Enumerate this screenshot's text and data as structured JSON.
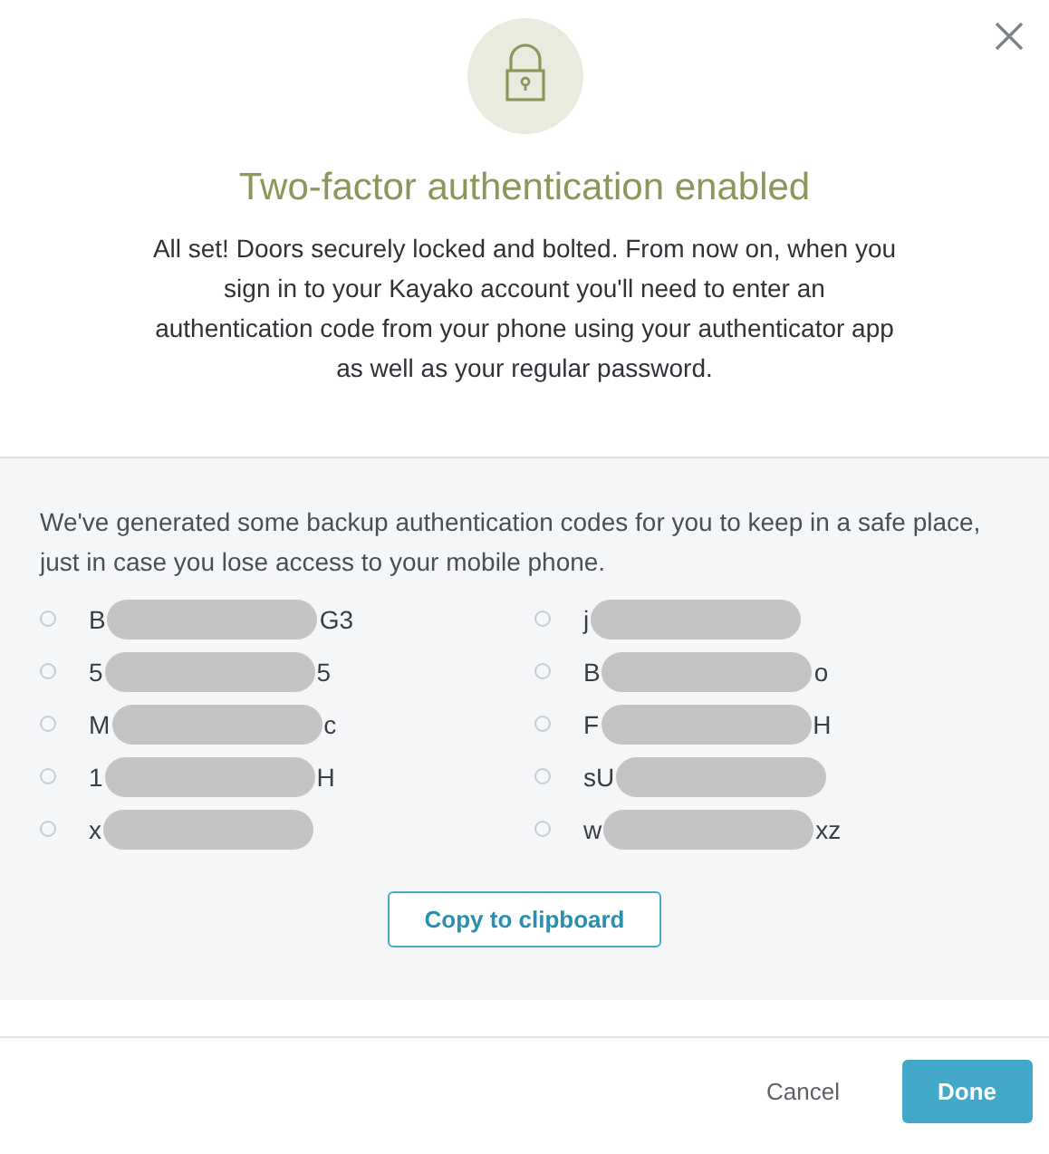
{
  "dialog": {
    "title": "Two-factor authentication enabled",
    "message": "All set! Doors securely locked and bolted. From now on, when you sign in to your Kayako account you'll need to enter an authentication code from your phone using your authenticator app as well as your regular password.",
    "backup_intro": "We've generated some backup authentication codes for you to keep in a safe place, just in case you lose access to your mobile phone.",
    "codes": [
      {
        "prefix": "B",
        "suffix": "G3"
      },
      {
        "prefix": "j"
      },
      {
        "prefix": "5",
        "suffix": "5"
      },
      {
        "prefix": "B",
        "suffix": "o"
      },
      {
        "prefix": "M",
        "suffix": "c"
      },
      {
        "prefix": "F",
        "suffix": "H"
      },
      {
        "prefix": "1",
        "suffix": "H"
      },
      {
        "prefix": "sU"
      },
      {
        "prefix": "x"
      },
      {
        "prefix": "w",
        "suffix": "xz"
      }
    ],
    "copy_button": "Copy to clipboard",
    "buttons": [
      {
        "label": "Cancel",
        "kind": "secondary"
      },
      {
        "label": "Done",
        "kind": "primary"
      }
    ]
  }
}
